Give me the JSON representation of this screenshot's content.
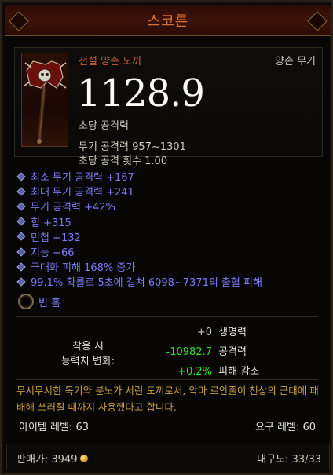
{
  "item": {
    "name": "스코른",
    "rarity_type": "전설 양손 도끼",
    "slot": "양손 무기",
    "dps": "1128.9",
    "dps_label": "초당 공격력",
    "weapon_damage": "무기 공격력 957~1301",
    "attack_speed": "초당 공격 횟수 1.00"
  },
  "affixes": [
    "최소 무기 공격력 +167",
    "최대 무기 공격력 +241",
    "무기 공격력 +42%",
    "힘 +315",
    "민첩 +132",
    "지능 +66",
    "극대화 피해 168% 증가",
    "99.1% 확률로 5초에 걸쳐 6098~7371의 출혈 피해"
  ],
  "socket": {
    "label": "빈 홈"
  },
  "comparison": {
    "label": "착용 시\n능력치 변화:",
    "rows": [
      {
        "value": "+0",
        "stat": "생명력",
        "color": "#cfcbbd"
      },
      {
        "value": "-10982.7",
        "stat": "공격력",
        "color": "#2ee02e"
      },
      {
        "value": "+0.2%",
        "stat": "피해 감소",
        "color": "#2ee02e"
      }
    ]
  },
  "flavor": "무시무시한 독기와 분노가 서린 도끼로서, 악마 르안줄이 천상의 군대에 패배해 쓰러질 때까지 사용했다고 합니다.",
  "levels": {
    "item_level": "아이템 레벨: 63",
    "required_level": "요구 레벨: 60"
  },
  "footer": {
    "sell_price": "판매가: 3949",
    "durability": "내구도: 33/33"
  },
  "colors": {
    "legendary": "#cf5f2e",
    "magic": "#7d7bf6",
    "flavor": "#c9a040",
    "positive": "#2ee02e"
  },
  "icons": {
    "item": "battle-axe-icon",
    "socket": "empty-socket-icon",
    "gold": "gold-coin-icon"
  }
}
